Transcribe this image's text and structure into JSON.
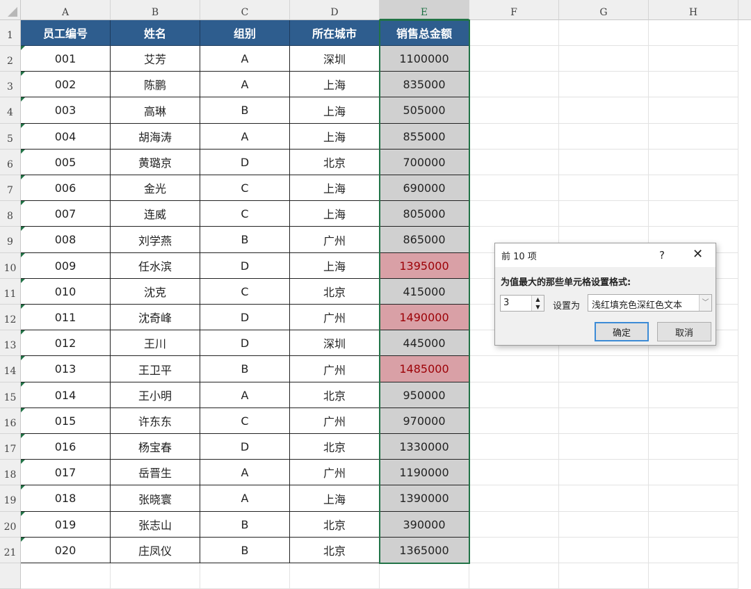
{
  "columns": [
    "A",
    "B",
    "C",
    "D",
    "E",
    "F",
    "G",
    "H"
  ],
  "header": [
    "员工编号",
    "姓名",
    "组别",
    "所在城市",
    "销售总金额"
  ],
  "rows": [
    [
      "001",
      "艾芳",
      "A",
      "深圳",
      "1100000"
    ],
    [
      "002",
      "陈鹏",
      "A",
      "上海",
      "835000"
    ],
    [
      "003",
      "高琳",
      "B",
      "上海",
      "505000"
    ],
    [
      "004",
      "胡海涛",
      "A",
      "上海",
      "855000"
    ],
    [
      "005",
      "黄璐京",
      "D",
      "北京",
      "700000"
    ],
    [
      "006",
      "金光",
      "C",
      "上海",
      "690000"
    ],
    [
      "007",
      "连威",
      "C",
      "上海",
      "805000"
    ],
    [
      "008",
      "刘学燕",
      "B",
      "广州",
      "865000"
    ],
    [
      "009",
      "任水滨",
      "D",
      "上海",
      "1395000"
    ],
    [
      "010",
      "沈克",
      "C",
      "北京",
      "415000"
    ],
    [
      "011",
      "沈奇峰",
      "D",
      "广州",
      "1490000"
    ],
    [
      "012",
      "王川",
      "D",
      "深圳",
      "445000"
    ],
    [
      "013",
      "王卫平",
      "B",
      "广州",
      "1485000"
    ],
    [
      "014",
      "王小明",
      "A",
      "北京",
      "950000"
    ],
    [
      "015",
      "许东东",
      "C",
      "广州",
      "970000"
    ],
    [
      "016",
      "杨宝春",
      "D",
      "北京",
      "1330000"
    ],
    [
      "017",
      "岳晋生",
      "A",
      "广州",
      "1190000"
    ],
    [
      "018",
      "张晓寰",
      "A",
      "上海",
      "1390000"
    ],
    [
      "019",
      "张志山",
      "B",
      "北京",
      "390000"
    ],
    [
      "020",
      "庄凤仪",
      "B",
      "北京",
      "1365000"
    ]
  ],
  "highlighted_rows": [
    8,
    10,
    12
  ],
  "colors": {
    "header_fill": "#2e5d8e",
    "highlight_fill": "#d9a0a6",
    "highlight_text": "#9c0006",
    "selection": "#217346"
  },
  "dialog": {
    "title": "前 10 项",
    "help": "?",
    "close": "✕",
    "label": "为值最大的那些单元格设置格式:",
    "count": "3",
    "set_as": "设置为",
    "format": "浅红填充色深红色文本",
    "ok": "确定",
    "cancel": "取消"
  }
}
